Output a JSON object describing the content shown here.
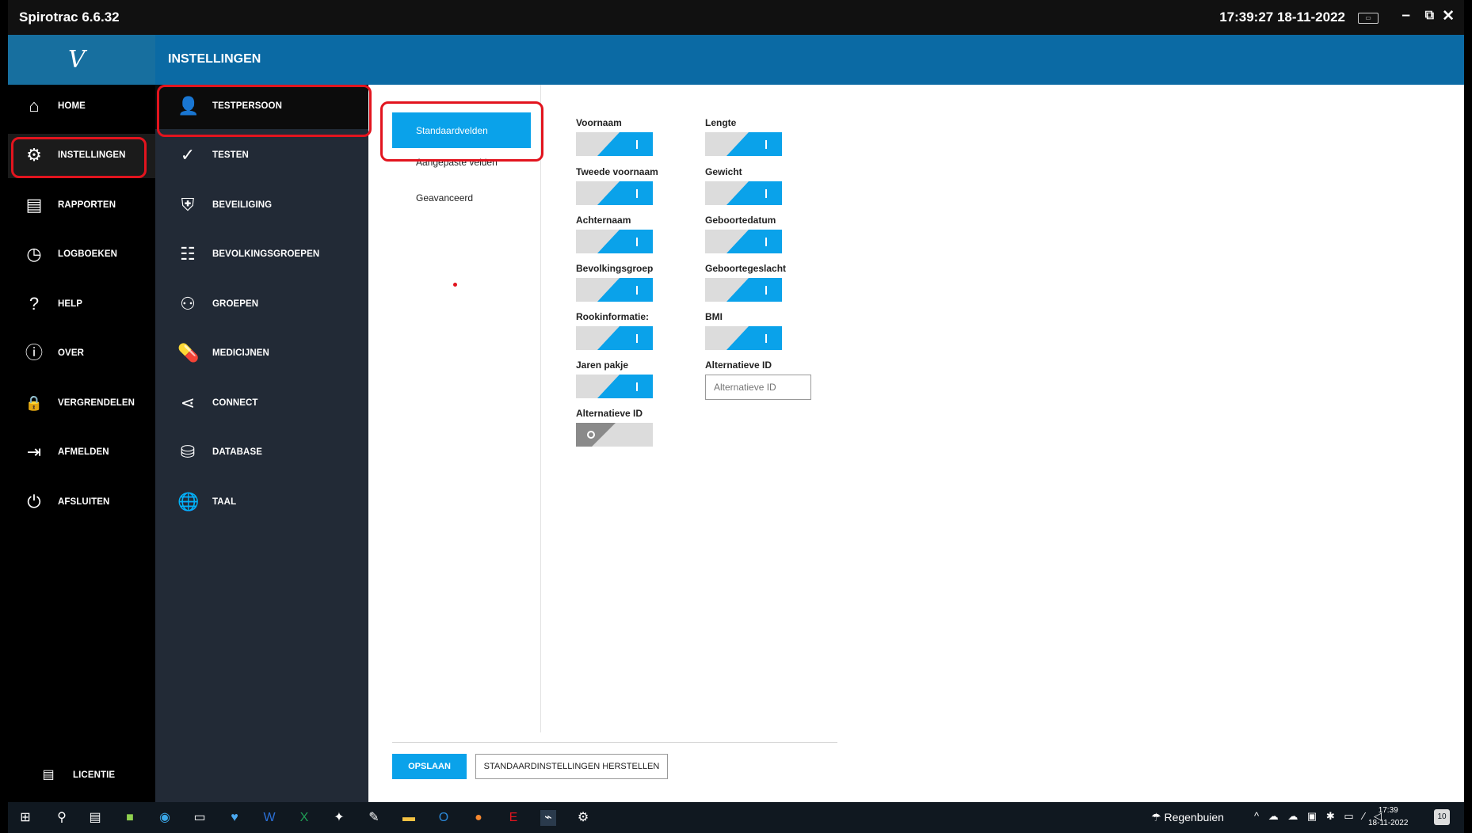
{
  "titlebar": {
    "app_title": "Spirotrac 6.6.32",
    "datetime": "17:39:27 18-11-2022",
    "keyboard_icon": "keyboard-icon",
    "minimize": "–",
    "restore": "⧉",
    "close": "✕"
  },
  "header": {
    "title": "INSTELLINGEN",
    "logo": "V"
  },
  "nav_main": {
    "items": [
      {
        "label": "HOME",
        "icon": "home-icon",
        "glyph": "⌂"
      },
      {
        "label": "INSTELLINGEN",
        "icon": "gear-icon",
        "glyph": "⚙"
      },
      {
        "label": "RAPPORTEN",
        "icon": "report-icon",
        "glyph": "▤"
      },
      {
        "label": "LOGBOEKEN",
        "icon": "clock-icon",
        "glyph": "◷"
      },
      {
        "label": "HELP",
        "icon": "help-icon",
        "glyph": "?"
      },
      {
        "label": "OVER",
        "icon": "info-icon",
        "glyph": "ⓘ"
      },
      {
        "label": "VERGRENDELEN",
        "icon": "lock-icon",
        "glyph": "🔒"
      },
      {
        "label": "AFMELDEN",
        "icon": "logout-icon",
        "glyph": "⇥"
      },
      {
        "label": "AFSLUITEN",
        "icon": "power-icon",
        "glyph": "⏻"
      }
    ],
    "footer_label": "LICENTIE"
  },
  "nav_settings": {
    "items": [
      {
        "label": "TESTPERSOON",
        "icon": "person-settings-icon",
        "glyph": "👤"
      },
      {
        "label": "TESTEN",
        "icon": "chart-check-icon",
        "glyph": "✓"
      },
      {
        "label": "BEVEILIGING",
        "icon": "shield-icon",
        "glyph": "⛨"
      },
      {
        "label": "BEVOLKINGSGROEPEN",
        "icon": "population-icon",
        "glyph": "☷"
      },
      {
        "label": "GROEPEN",
        "icon": "groups-icon",
        "glyph": "⚇"
      },
      {
        "label": "MEDICIJNEN",
        "icon": "medicine-icon",
        "glyph": "💊"
      },
      {
        "label": "CONNECT",
        "icon": "share-icon",
        "glyph": "⋖"
      },
      {
        "label": "DATABASE",
        "icon": "database-icon",
        "glyph": "⛁"
      },
      {
        "label": "TAAL",
        "icon": "globe-icon",
        "glyph": "🌐"
      }
    ]
  },
  "subtabs": [
    "Standaardvelden",
    "Aangepaste velden",
    "Geavanceerd"
  ],
  "fields_left": [
    {
      "label": "Voornaam",
      "state": "on"
    },
    {
      "label": "Tweede voornaam",
      "state": "on"
    },
    {
      "label": "Achternaam",
      "state": "on"
    },
    {
      "label": "Bevolkingsgroep",
      "state": "on"
    },
    {
      "label": "Rookinformatie:",
      "state": "on"
    },
    {
      "label": "Jaren pakje",
      "state": "on"
    },
    {
      "label": "Alternatieve ID",
      "state": "off"
    }
  ],
  "fields_right": [
    {
      "label": "Lengte",
      "state": "on"
    },
    {
      "label": "Gewicht",
      "state": "on"
    },
    {
      "label": "Geboortedatum",
      "state": "on"
    },
    {
      "label": "Geboortegeslacht",
      "state": "on"
    },
    {
      "label": "BMI",
      "state": "on"
    }
  ],
  "alt_id_input": {
    "label": "Alternatieve ID",
    "placeholder": "Alternatieve ID"
  },
  "buttons": {
    "save": "OPSLAAN",
    "reset": "STANDAARDINSTELLINGEN HERSTELLEN"
  },
  "taskbar": {
    "weather": "Regenbuien",
    "time": "17:39",
    "date": "18-11-2022",
    "notifications": "10"
  },
  "colors": {
    "accent": "#0aa2ea",
    "header": "#0b6aa4",
    "highlight": "#e2141e"
  }
}
